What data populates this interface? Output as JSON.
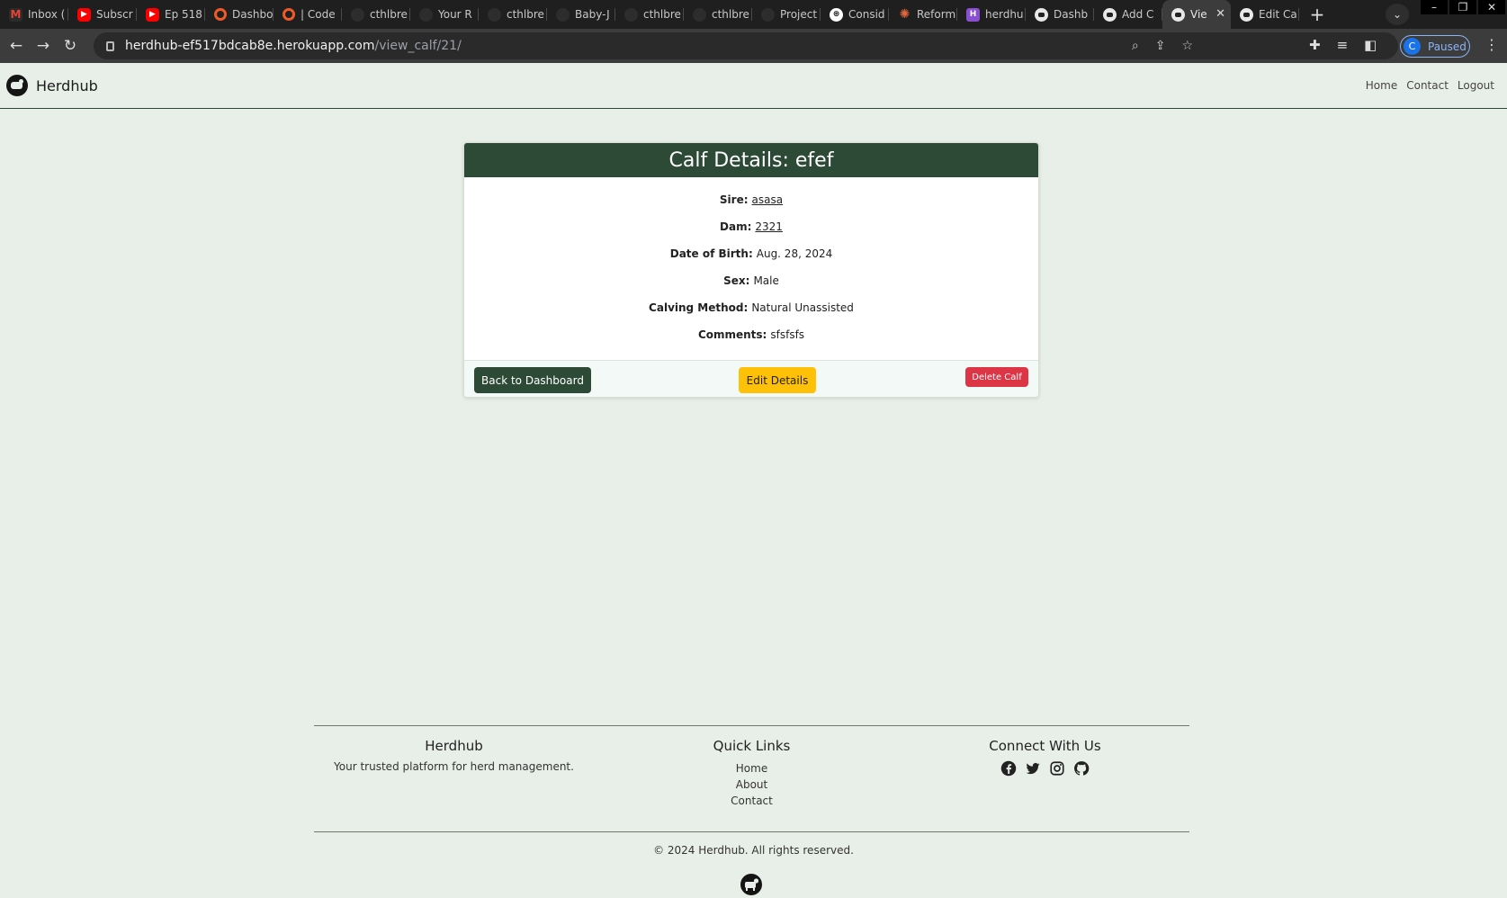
{
  "browser": {
    "tabs": [
      {
        "label": "Inbox (",
        "favicon": "gmail-icon"
      },
      {
        "label": "Subscr",
        "favicon": "youtube-icon"
      },
      {
        "label": "Ep 518",
        "favicon": "youtube-icon"
      },
      {
        "label": "Dashbo",
        "favicon": "ring-icon"
      },
      {
        "label": "| Code",
        "favicon": "ring-icon"
      },
      {
        "label": "cthlbre",
        "favicon": "github-icon"
      },
      {
        "label": "Your R",
        "favicon": "github-icon"
      },
      {
        "label": "cthlbre",
        "favicon": "github-icon"
      },
      {
        "label": "Baby-J",
        "favicon": "github-icon"
      },
      {
        "label": "cthlbre",
        "favicon": "github-icon"
      },
      {
        "label": "cthlbre",
        "favicon": "github-icon"
      },
      {
        "label": "Project",
        "favicon": "github-icon"
      },
      {
        "label": "Consid",
        "favicon": "openai-icon"
      },
      {
        "label": "Reform",
        "favicon": "sparkle-icon"
      },
      {
        "label": "herdhu",
        "favicon": "heroku-icon"
      },
      {
        "label": "Dashb",
        "favicon": "herdhub-icon"
      },
      {
        "label": "Add C",
        "favicon": "herdhub-icon"
      },
      {
        "label": "Vie",
        "favicon": "herdhub-icon",
        "active": true
      },
      {
        "label": "Edit Ca",
        "favicon": "herdhub-icon"
      }
    ],
    "url_host": "herdhub-ef517bdcab8e.herokuapp.com",
    "url_path": "/view_calf/21/",
    "profile_initial": "C",
    "profile_status": "Paused"
  },
  "site": {
    "brand": "Herdhub",
    "nav": [
      "Home",
      "Contact",
      "Logout"
    ]
  },
  "calf": {
    "title": "Calf Details: efef",
    "details": [
      {
        "key": "Sire:",
        "value": "asasa",
        "link": true
      },
      {
        "key": "Dam:",
        "value": "2321",
        "link": true
      },
      {
        "key": "Date of Birth:",
        "value": "Aug. 28, 2024",
        "link": false
      },
      {
        "key": "Sex:",
        "value": "Male",
        "link": false
      },
      {
        "key": "Calving Method:",
        "value": "Natural Unassisted",
        "link": false
      },
      {
        "key": "Comments:",
        "value": "sfsfsfs",
        "link": false
      }
    ],
    "buttons": {
      "back": "Back to Dashboard",
      "edit": "Edit Details",
      "delete": "Delete Calf"
    }
  },
  "footer": {
    "about_title": "Herdhub",
    "about_text": "Your trusted platform for herd management.",
    "links_title": "Quick Links",
    "links": [
      "Home",
      "About",
      "Contact"
    ],
    "social_title": "Connect With Us",
    "social": [
      "facebook-icon",
      "twitter-icon",
      "instagram-icon",
      "github-icon"
    ],
    "copyright": "© 2024 Herdhub. All rights reserved."
  },
  "colors": {
    "primary_green": "#2c4a35",
    "page_bg": "#e8efe8",
    "edit_yellow": "#ffc107",
    "delete_red": "#dc3545"
  }
}
